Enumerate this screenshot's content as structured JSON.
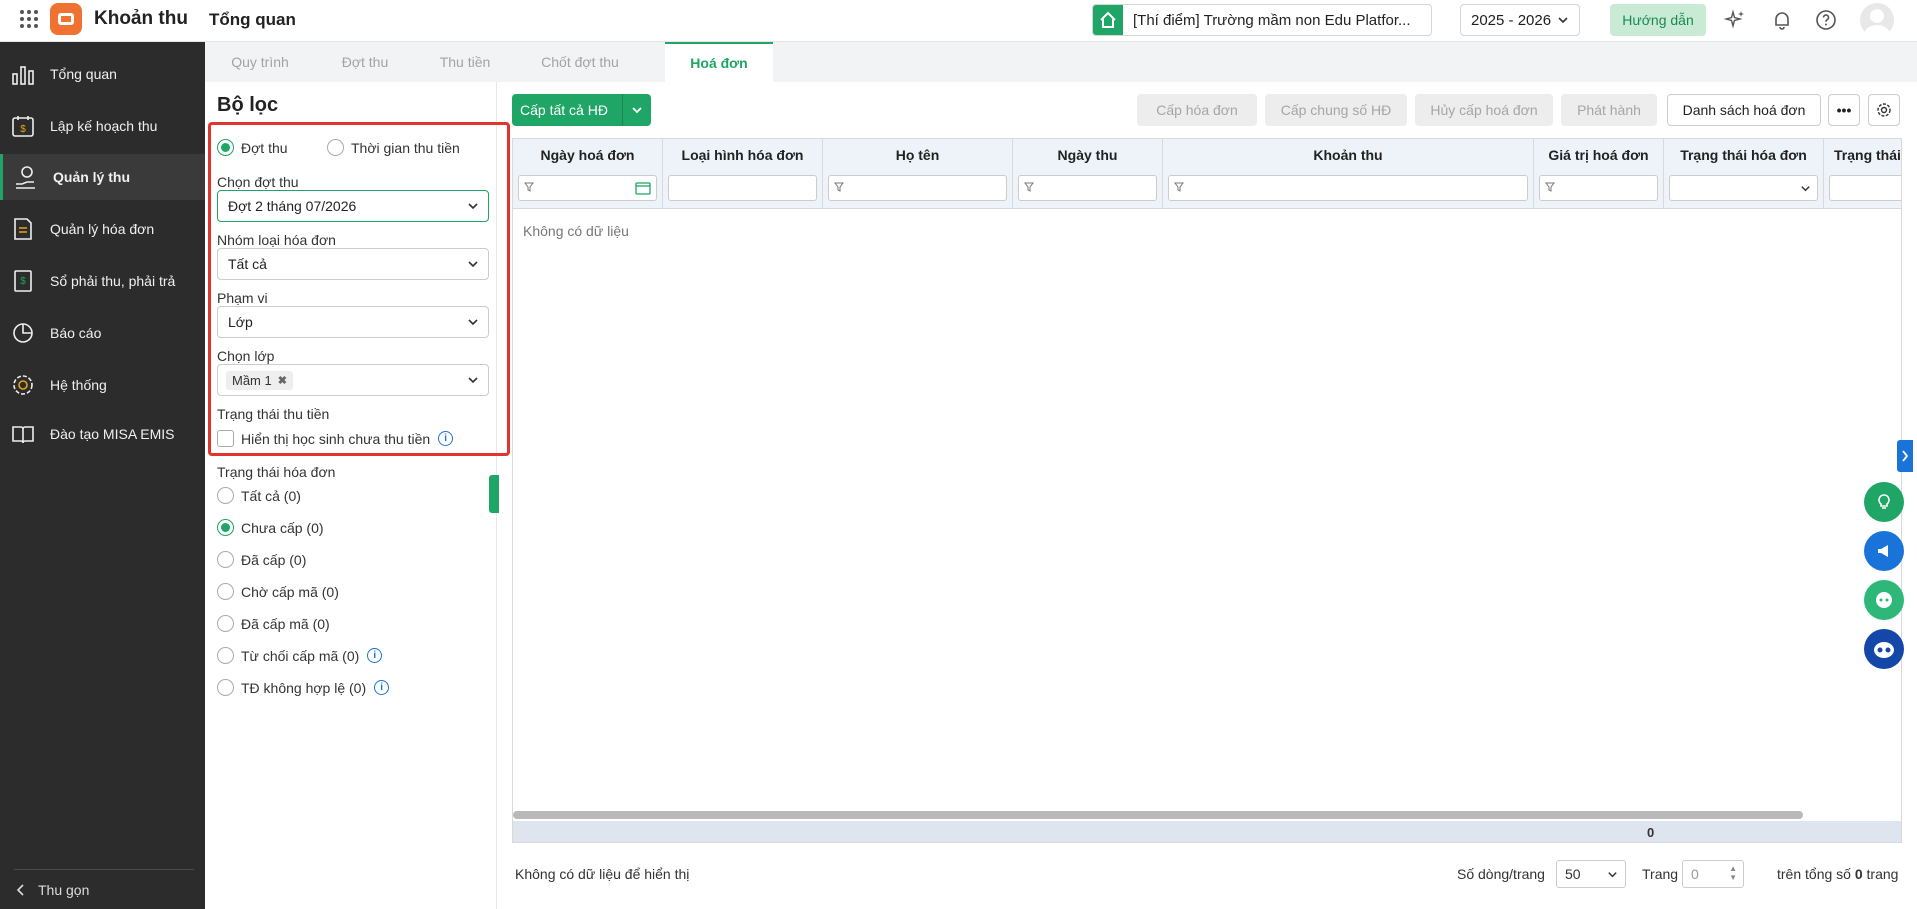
{
  "app": {
    "title": "Khoản thu",
    "page_title": "Tổng quan",
    "school": "[Thí điểm] Trường mầm non Edu Platfor...",
    "year": "2025 - 2026",
    "guide": "Hướng dẫn"
  },
  "sidebar": {
    "items": [
      {
        "label": "Tổng quan",
        "icon": "bar-chart-icon"
      },
      {
        "label": "Lập kế hoạch thu",
        "icon": "calendar-money-icon"
      },
      {
        "label": "Quản lý thu",
        "icon": "hand-coin-icon"
      },
      {
        "label": "Quản lý hóa đơn",
        "icon": "invoice-icon"
      },
      {
        "label": "Sổ phải thu, phải trả",
        "icon": "ledger-icon"
      },
      {
        "label": "Báo cáo",
        "icon": "pie-chart-icon"
      },
      {
        "label": "Hệ thống",
        "icon": "gear-icon"
      },
      {
        "label": "Đào tạo MISA EMIS",
        "icon": "book-icon"
      }
    ],
    "collapse": "Thu gọn"
  },
  "tabs": [
    "Quy trình",
    "Đợt thu",
    "Thu tiền",
    "Chốt đợt thu",
    "Hoá đơn"
  ],
  "filter": {
    "title": "Bộ lọc",
    "radio_dot_thu": "Đợt thu",
    "radio_thoi_gian": "Thời gian thu tiền",
    "chon_dot_thu_label": "Chọn đợt thu",
    "chon_dot_thu_value": "Đợt 2 tháng 07/2026",
    "nhom_loai_label": "Nhóm loại hóa đơn",
    "nhom_loai_value": "Tất cả",
    "pham_vi_label": "Phạm vi",
    "pham_vi_value": "Lớp",
    "chon_lop_label": "Chọn lớp",
    "chon_lop_tag": "Mầm 1",
    "trang_thai_thu_label": "Trạng thái thu tiền",
    "hien_thi_label": "Hiển thị học sinh chưa thu tiền",
    "trang_thai_hd_label": "Trạng thái hóa đơn",
    "statuses": [
      "Tất cả (0)",
      "Chưa cấp (0)",
      "Đã cấp (0)",
      "Chờ cấp mã (0)",
      "Đã cấp mã (0)",
      "Từ chối cấp mã (0)",
      "TĐ không hợp lệ (0)"
    ]
  },
  "toolbar": {
    "cap_tat_ca": "Cấp tất cả HĐ",
    "cap_hoa_don": "Cấp hóa đơn",
    "cap_chung_so": "Cấp chung số HĐ",
    "huy_cap": "Hủy cấp hoá đơn",
    "phat_hanh": "Phát hành",
    "danh_sach": "Danh sách hoá đơn"
  },
  "table": {
    "columns": [
      "Ngày hoá đơn",
      "Loại hình hóa đơn",
      "Họ tên",
      "Ngày thu",
      "Khoản thu",
      "Giá trị hoá đơn",
      "Trạng thái hóa đơn",
      "Trạng thái"
    ],
    "empty": "Không có dữ liệu",
    "total": "0"
  },
  "footer": {
    "no_data": "Không có dữ liệu để hiển thị",
    "rows_label": "Số dòng/trang",
    "rows_value": "50",
    "page_label": "Trang",
    "page_value": "0",
    "total_prefix": "trên tổng số",
    "total_pages": "0",
    "total_suffix": "trang"
  },
  "colors": {
    "accent": "#1fa565",
    "highlight": "#e0342f",
    "sidebar": "#2c2c2c"
  }
}
